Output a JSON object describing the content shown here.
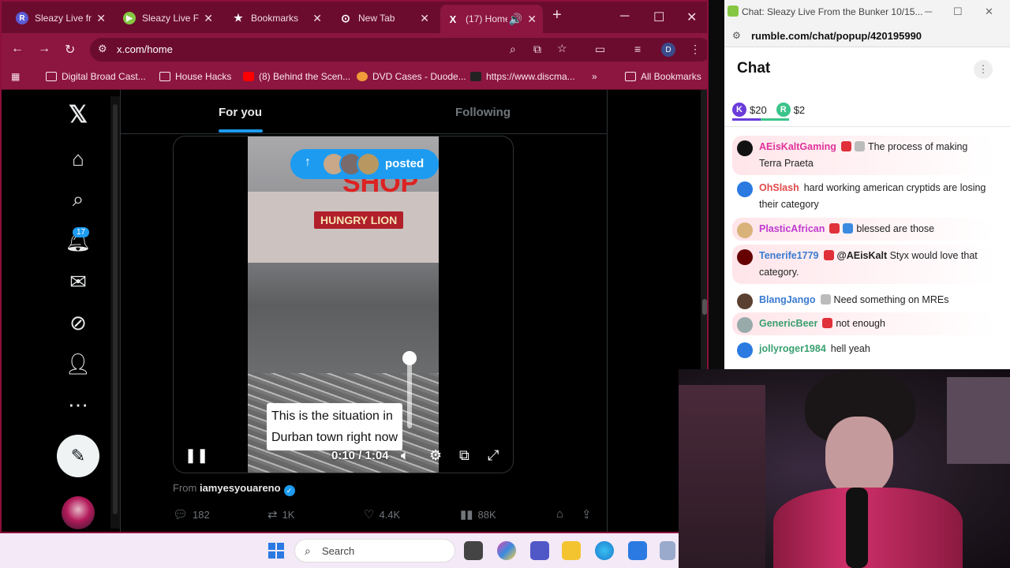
{
  "browser": {
    "tabs": [
      {
        "label": "Sleazy Live fro",
        "icon": "R",
        "color": "#5b5bd6"
      },
      {
        "label": "Sleazy Live Fr",
        "icon": "▶",
        "color": "#85c742"
      },
      {
        "label": "Bookmarks",
        "icon": "★",
        "color": "transparent"
      },
      {
        "label": "New Tab",
        "icon": "⊙",
        "color": "transparent"
      },
      {
        "label": "(17) Home",
        "icon": "X",
        "color": "transparent"
      }
    ],
    "new_tab": "+",
    "url": "x.com/home",
    "profile_initial": "D",
    "bookmarks": [
      "Digital Broad Cast...",
      "House Hacks",
      "(8) Behind the Scen...",
      "DVD Cases - Duode...",
      "https://www.discma...",
      "»",
      "All Bookmarks"
    ]
  },
  "x": {
    "notifications_count": "17",
    "tabs": {
      "for_you": "For you",
      "following": "Following"
    },
    "video": {
      "posted_label": "posted",
      "caption_line1": "This is the situation in",
      "caption_line2": "Durban town right now",
      "time": "0:10 / 1:04",
      "sign_text": "HUNGRY LION",
      "top_sign": "SHOP"
    },
    "from_prefix": "From ",
    "from_user": "iamyesyouareno",
    "stats": {
      "replies": "182",
      "reposts": "1K",
      "likes": "4.4K",
      "views": "88K"
    }
  },
  "chat": {
    "window_title": "Chat: Sleazy Live From the Bunker 10/15...",
    "url": "rumble.com/chat/popup/420195990",
    "heading": "Chat",
    "tips": [
      {
        "badge": "K",
        "amount": "$20",
        "color": "#6b3bd9"
      },
      {
        "badge": "R",
        "amount": "$2",
        "color": "#3bc48a"
      }
    ],
    "messages": [
      {
        "user": "AEisKaltGaming",
        "text": "The process of making Terra Praeta",
        "color": "#e0339a",
        "highlight": true
      },
      {
        "user": "OhSlash",
        "text": "hard working american cryptids are losing their category",
        "color": "#e04a4a",
        "highlight": false
      },
      {
        "user": "PlasticAfrican",
        "text": "blessed are those",
        "color": "#c03ad0",
        "highlight": true
      },
      {
        "user": "Tenerife1779",
        "mention": "@AEisKalt",
        "text": " Styx would love that category.",
        "color": "#3a7ad0",
        "highlight": true
      },
      {
        "user": "BlangJango",
        "text": "Need something on MREs",
        "color": "#3a7ad0",
        "highlight": false
      },
      {
        "user": "GenericBeer",
        "text": "not enough",
        "color": "#3aa070",
        "highlight": true
      },
      {
        "user": "jollyroger1984",
        "text": "hell yeah",
        "color": "#3aa070",
        "highlight": false
      }
    ]
  },
  "taskbar": {
    "search_label": "Search"
  }
}
